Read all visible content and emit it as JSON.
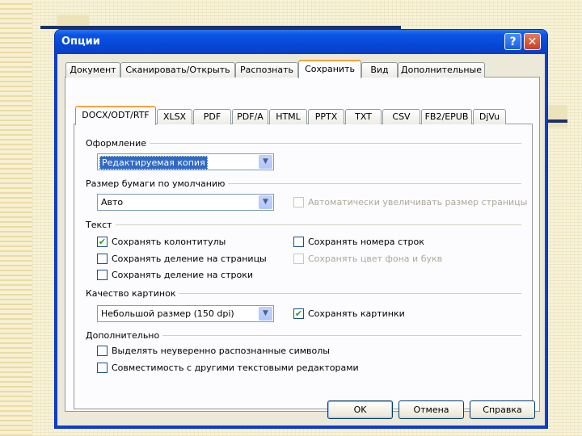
{
  "window": {
    "title": "Опции",
    "help_glyph": "?",
    "close_glyph": "✕"
  },
  "outer_tabs": [
    "Документ",
    "Сканировать/Открыть",
    "Распознать",
    "Сохранить",
    "Вид",
    "Дополнительные"
  ],
  "inner_tabs": [
    "DOCX/ODT/RTF",
    "XLSX",
    "PDF",
    "PDF/A",
    "HTML",
    "PPTX",
    "TXT",
    "CSV",
    "FB2/EPUB",
    "DjVu"
  ],
  "groups": {
    "formatting": {
      "label": "Оформление",
      "combo_value": "Редактируемая копия"
    },
    "paper": {
      "label": "Размер бумаги по умолчанию",
      "combo_value": "Авто",
      "auto_enlarge_label": "Автоматически увеличивать размер страницы",
      "auto_enlarge_checked": false
    },
    "text": {
      "label": "Текст",
      "keep_headers_label": "Сохранять колонтитулы",
      "keep_headers_checked": true,
      "keep_line_numbers_label": "Сохранять номера строк",
      "keep_line_numbers_checked": false,
      "keep_page_breaks_label": "Сохранять деление на страницы",
      "keep_page_breaks_checked": false,
      "keep_bg_color_label": "Сохранять цвет фона и букв",
      "keep_bg_color_checked": false,
      "keep_line_breaks_label": "Сохранять деление на строки",
      "keep_line_breaks_checked": false
    },
    "images": {
      "label": "Качество картинок",
      "combo_value": "Небольшой размер (150 dpi)",
      "keep_images_label": "Сохранять картинки",
      "keep_images_checked": true
    },
    "extra": {
      "label": "Дополнительно",
      "highlight_uncertain_label": "Выделять неуверенно распознанные символы",
      "highlight_uncertain_checked": false,
      "compat_label": "Совместимость с другими текстовыми редакторами",
      "compat_checked": false
    }
  },
  "buttons": {
    "ok": "OK",
    "cancel": "Отмена",
    "help": "Справка"
  },
  "check_glyph": "✔",
  "arrow_glyph": "▼"
}
